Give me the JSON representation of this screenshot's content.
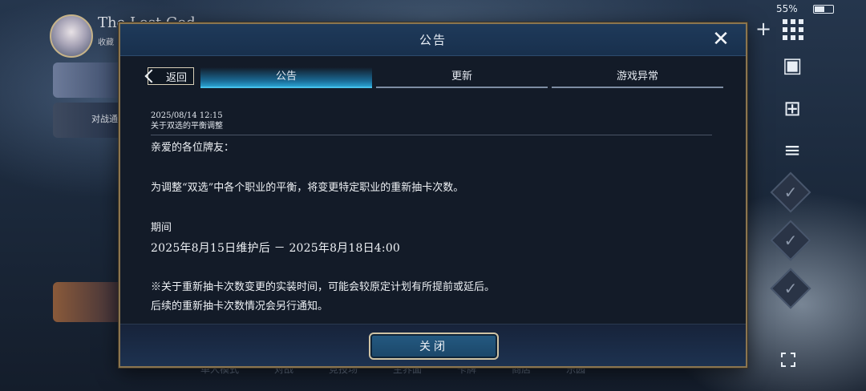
{
  "status": {
    "battery": "55%"
  },
  "player": {
    "name": "The Lost God",
    "sub": "收藏"
  },
  "left_panel": {
    "item_battle": "对战通"
  },
  "bottom_nav": [
    "单人模式",
    "对战",
    "竞技场",
    "主界面",
    "卡牌",
    "商店",
    "乐园"
  ],
  "dialog": {
    "title": "公告",
    "back_label": "返回",
    "tabs": [
      {
        "label": "公告",
        "active": true
      },
      {
        "label": "更新",
        "active": false
      },
      {
        "label": "游戏异常",
        "active": false
      }
    ],
    "notice": {
      "date": "2025/08/14  12:15",
      "subject": "关于双选的平衡调整",
      "greeting": "亲爱的各位牌友：",
      "body": "为调整“双选”中各个职业的平衡，将变更特定职业的重新抽卡次数。",
      "period_label": "期间",
      "period_value": "2025年8月15日维护后 － 2025年8月18日4:00",
      "note1": "※关于重新抽卡次数变更的实装时间，可能会较原定计划有所提前或延后。",
      "note2": "后续的重新抽卡次数情况会另行通知。"
    },
    "close_button": "关闭"
  },
  "colors": {
    "accent_tab": "#2aa0cf",
    "frame_gold": "#8a7550",
    "dialog_bg": "#131b28"
  },
  "icons": [
    "close-icon",
    "back-chevron-icon",
    "plus-icon",
    "grid-menu-icon",
    "gallery-icon",
    "gift-icon",
    "scroll-icon",
    "check-icon",
    "fullscreen-icon"
  ]
}
